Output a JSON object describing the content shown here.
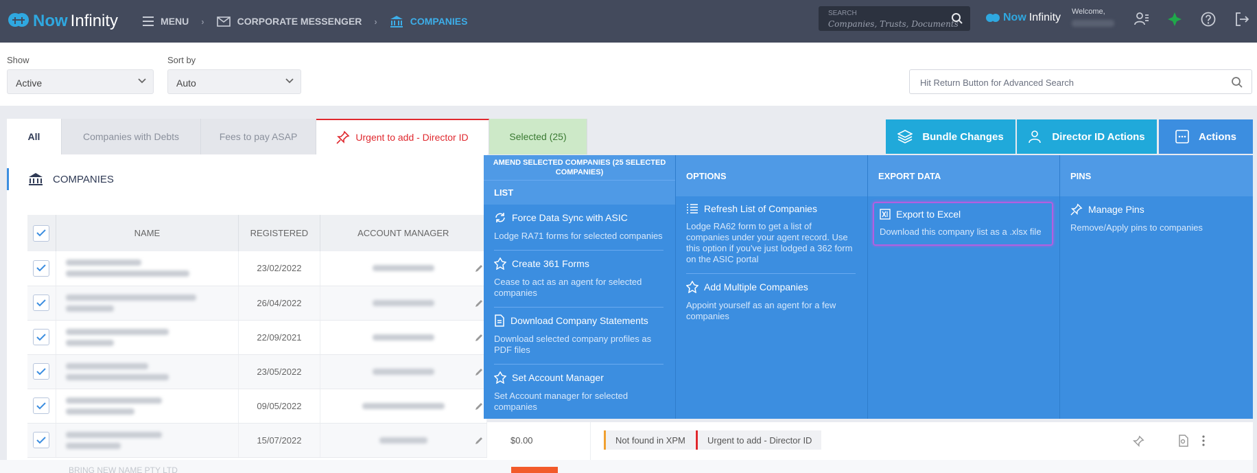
{
  "topbar": {
    "logo_a": "Now",
    "logo_b": "Infinity",
    "breadcrumb": {
      "menu": "MENU",
      "corporate_messenger": "CORPORATE MESSENGER",
      "companies": "COMPANIES"
    },
    "search": {
      "label": "SEARCH",
      "placeholder": "Companies, Trusts, Documents"
    },
    "welcome": "Welcome,"
  },
  "filters": {
    "show_label": "Show",
    "show_value": "Active",
    "sort_label": "Sort by",
    "sort_value": "Auto",
    "advanced_search_placeholder": "Hit Return Button for Advanced Search"
  },
  "tabs": [
    {
      "label": "All"
    },
    {
      "label": "Companies with Debts"
    },
    {
      "label": "Fees to pay ASAP"
    },
    {
      "label": "Urgent to add - Director ID"
    },
    {
      "label": "Selected (25)"
    }
  ],
  "toolbar": {
    "bundle_changes": "Bundle Changes",
    "director_id_actions": "Director ID Actions",
    "actions": "Actions"
  },
  "section_title": "COMPANIES",
  "table": {
    "headers": [
      "NAME",
      "REGISTERED",
      "ACCOUNT MANAGER"
    ],
    "rows": [
      {
        "registered": "23/02/2022"
      },
      {
        "registered": "26/04/2022"
      },
      {
        "registered": "22/09/2021"
      },
      {
        "registered": "23/05/2022"
      },
      {
        "registered": "09/05/2022"
      },
      {
        "registered": "15/07/2022"
      }
    ]
  },
  "mega_menu": {
    "list": {
      "header_top": "AMEND SELECTED COMPANIES (25 SELECTED COMPANIES)",
      "header": "LIST",
      "items": [
        {
          "title": "Force Data Sync with ASIC",
          "desc": "Lodge RA71 forms for selected companies"
        },
        {
          "title": "Create 361 Forms",
          "desc": "Cease to act as an agent for selected companies"
        },
        {
          "title": "Download Company Statements",
          "desc": "Download selected company profiles as PDF files"
        },
        {
          "title": "Set Account Manager",
          "desc": "Set Account manager for selected companies"
        }
      ]
    },
    "options": {
      "header": "OPTIONS",
      "items": [
        {
          "title": "Refresh List of Companies",
          "desc": "Lodge RA62 form to get a list of companies under your agent record. Use this option if you've just lodged a 362 form on the ASIC portal"
        },
        {
          "title": "Add Multiple Companies",
          "desc": "Appoint yourself as an agent for a few companies"
        }
      ]
    },
    "export": {
      "header": "EXPORT DATA",
      "items": [
        {
          "title": "Export to Excel",
          "desc": "Download this company list as a .xlsx file"
        }
      ]
    },
    "pins": {
      "header": "PINS",
      "items": [
        {
          "title": "Manage Pins",
          "desc": "Remove/Apply pins to companies"
        }
      ]
    }
  },
  "bottom_row": {
    "amount": "$0.00",
    "tag1": "Not found in XPM",
    "tag2": "Urgent to add - Director ID"
  },
  "partial_row_name": "BRING NEW NAME PTY LTD",
  "colors": {
    "topbar": "#434a5c",
    "accent_blue": "#3c8ee0",
    "teal_button": "#20a9da",
    "urgent_red": "#e0282e",
    "selected_green": "#cde9c8",
    "highlight_purple": "#b35fe0"
  }
}
